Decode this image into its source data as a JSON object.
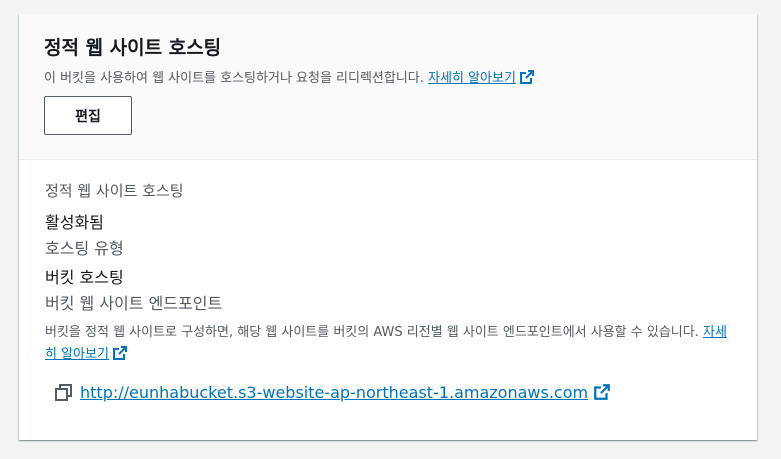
{
  "header": {
    "title": "정적 웹 사이트 호스팅",
    "description": "이 버킷을 사용하여 웹 사이트를 호스팅하거나 요청을 리디렉션합니다.",
    "learn_more": "자세히 알아보기",
    "edit_button": "편집"
  },
  "body": {
    "section_label": "정적 웹 사이트 호스팅",
    "status_value": "활성화됨",
    "hosting_type_label": "호스팅 유형",
    "hosting_type_value": "버킷 호스팅",
    "endpoint_label": "버킷 웹 사이트 엔드포인트",
    "endpoint_help": "버킷을 정적 웹 사이트로 구성하면, 해당 웹 사이트를 버킷의 AWS 리전별 웹 사이트 엔드포인트에서 사용할 수 있습니다.",
    "learn_more": "자세히 알아보기",
    "endpoint_url": "http://eunhabucket.s3-website-ap-northeast-1.amazonaws.com"
  },
  "icons": {
    "external": "external-link-icon",
    "copy": "copy-icon"
  },
  "colors": {
    "link": "#0073bb",
    "text": "#16191f",
    "secondary_text": "#545b64",
    "header_bg": "#fafafa"
  }
}
